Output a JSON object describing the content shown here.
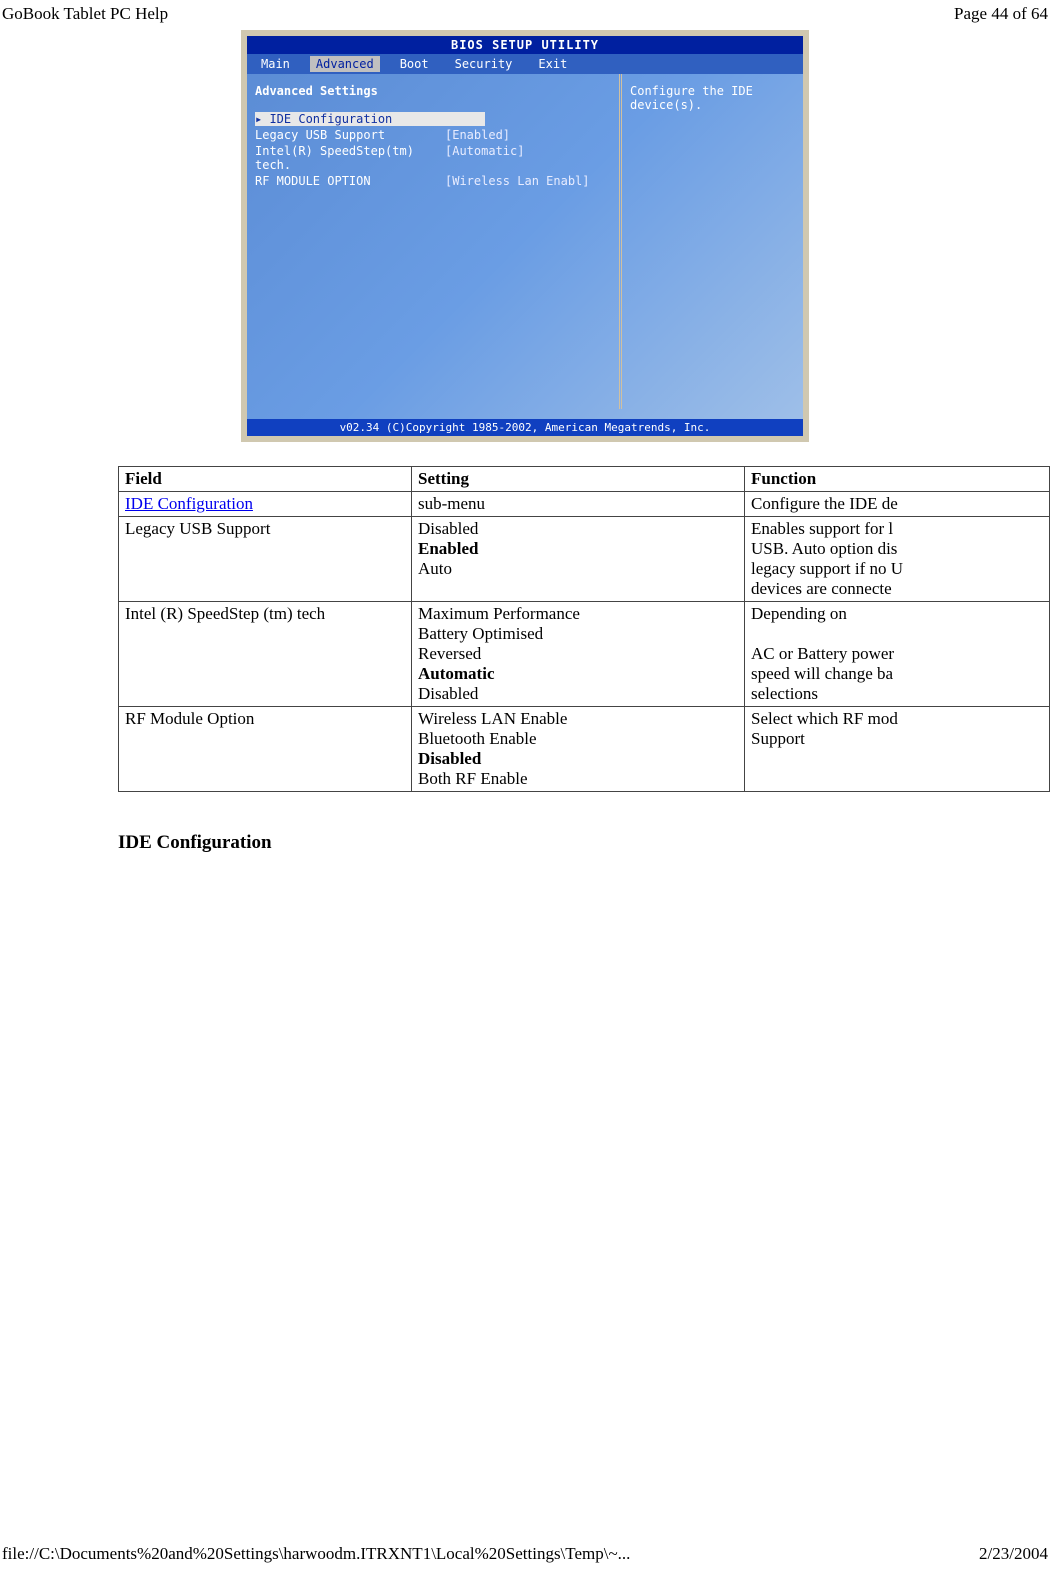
{
  "header": {
    "title": "GoBook Tablet PC Help",
    "page": "Page 44 of 64"
  },
  "bios": {
    "title": "BIOS SETUP UTILITY",
    "tabs": [
      "Main",
      "Advanced",
      "Boot",
      "Security",
      "Exit"
    ],
    "activeTab": "Advanced",
    "leftHeading": "Advanced Settings",
    "items": [
      {
        "label": "IDE Configuration",
        "value": "",
        "selected": true
      },
      {
        "label": "Legacy USB Support",
        "value": "[Enabled]"
      },
      {
        "label": "Intel(R) SpeedStep(tm) tech.",
        "value": "[Automatic]"
      },
      {
        "label": "RF MODULE OPTION",
        "value": "[Wireless Lan Enabl]"
      }
    ],
    "rightText1": "Configure the IDE",
    "rightText2": "device(s).",
    "footer": "v02.34 (C)Copyright 1985-2002, American Megatrends, Inc."
  },
  "table": {
    "headers": [
      "Field",
      "Setting",
      "Function"
    ],
    "rows": [
      {
        "field": "IDE Configuration",
        "fieldLink": true,
        "settings": [
          {
            "t": "sub-menu",
            "b": false
          }
        ],
        "function": "Configure the IDE de"
      },
      {
        "field": "Legacy USB Support",
        "settings": [
          {
            "t": "Disabled",
            "b": false
          },
          {
            "t": "Enabled",
            "b": true
          },
          {
            "t": "Auto",
            "b": false
          }
        ],
        "function": "Enables support for l\nUSB. Auto option dis\nlegacy support if no U\ndevices are connecte"
      },
      {
        "field": "Intel (R) SpeedStep (tm) tech",
        "settings": [
          {
            "t": "Maximum Performance",
            "b": false
          },
          {
            "t": "Battery Optimised",
            "b": false
          },
          {
            "t": "Reversed",
            "b": false
          },
          {
            "t": "Automatic",
            "b": true
          },
          {
            "t": "Disabled",
            "b": false
          }
        ],
        "function": "Depending on\n\nAC or Battery power\nspeed will change ba\nselections"
      },
      {
        "field": "RF Module Option",
        "settings": [
          {
            "t": "Wireless LAN Enable",
            "b": false
          },
          {
            "t": "Bluetooth Enable",
            "b": false
          },
          {
            "t": "Disabled",
            "b": true
          },
          {
            "t": "Both RF Enable",
            "b": false
          }
        ],
        "function": "Select which RF mod\nSupport"
      }
    ]
  },
  "subHeading": "IDE Configuration",
  "footer": {
    "path": "file://C:\\Documents%20and%20Settings\\harwoodm.ITRXNT1\\Local%20Settings\\Temp\\~...",
    "date": "2/23/2004"
  }
}
